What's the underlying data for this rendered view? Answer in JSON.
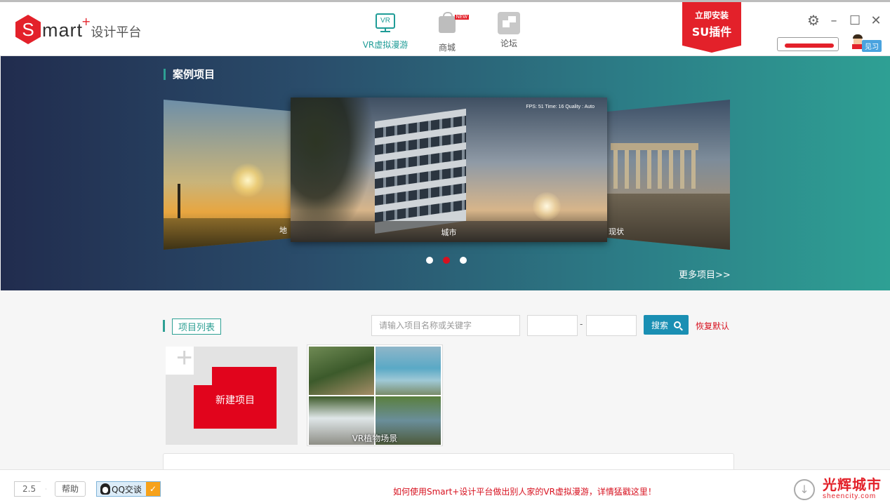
{
  "header": {
    "logo_letter": "S",
    "logo_text": "mart",
    "logo_plus": "+",
    "logo_subtitle": "设计平台",
    "nav": [
      {
        "label": "VR虚拟漫游",
        "icon": "vr-monitor-icon",
        "icon_text": "VR",
        "active": true
      },
      {
        "label": "商城",
        "icon": "shopping-bag-icon",
        "badge": "NEW"
      },
      {
        "label": "论坛",
        "icon": "forum-icon"
      }
    ],
    "su_banner": {
      "line1": "立即安装",
      "line2": "SU插件"
    },
    "user_tag": "见习"
  },
  "hero": {
    "title": "案例项目",
    "slides": [
      {
        "label": "地"
      },
      {
        "label": "城市",
        "hud": "FPS: 51  Time: 16  Quality : Auto"
      },
      {
        "label": "现状"
      }
    ],
    "active_dot": 1,
    "more_link": "更多项目>>"
  },
  "projects": {
    "title": "项目列表",
    "search_placeholder": "请输入项目名称或关键字",
    "range_separator": "-",
    "search_button": "搜索",
    "reset_link": "恢复默认",
    "new_project_label": "新建项目",
    "new_project_plus": "+",
    "cards": [
      {
        "label": "VR植物场景"
      }
    ]
  },
  "footer": {
    "version": "2.5",
    "help": "帮助",
    "qq": "QQ交谈",
    "qq_check": "✓",
    "notice": "如何使用Smart+设计平台做出别人家的VR虚拟漫游，详情猛戳这里！",
    "download_glyph": "↓",
    "brand_cn": "光辉城市",
    "brand_en": "sheencity.com"
  },
  "colors": {
    "accent_red": "#e3212a",
    "teal": "#2ea094",
    "search_blue": "#1a8fb3"
  }
}
